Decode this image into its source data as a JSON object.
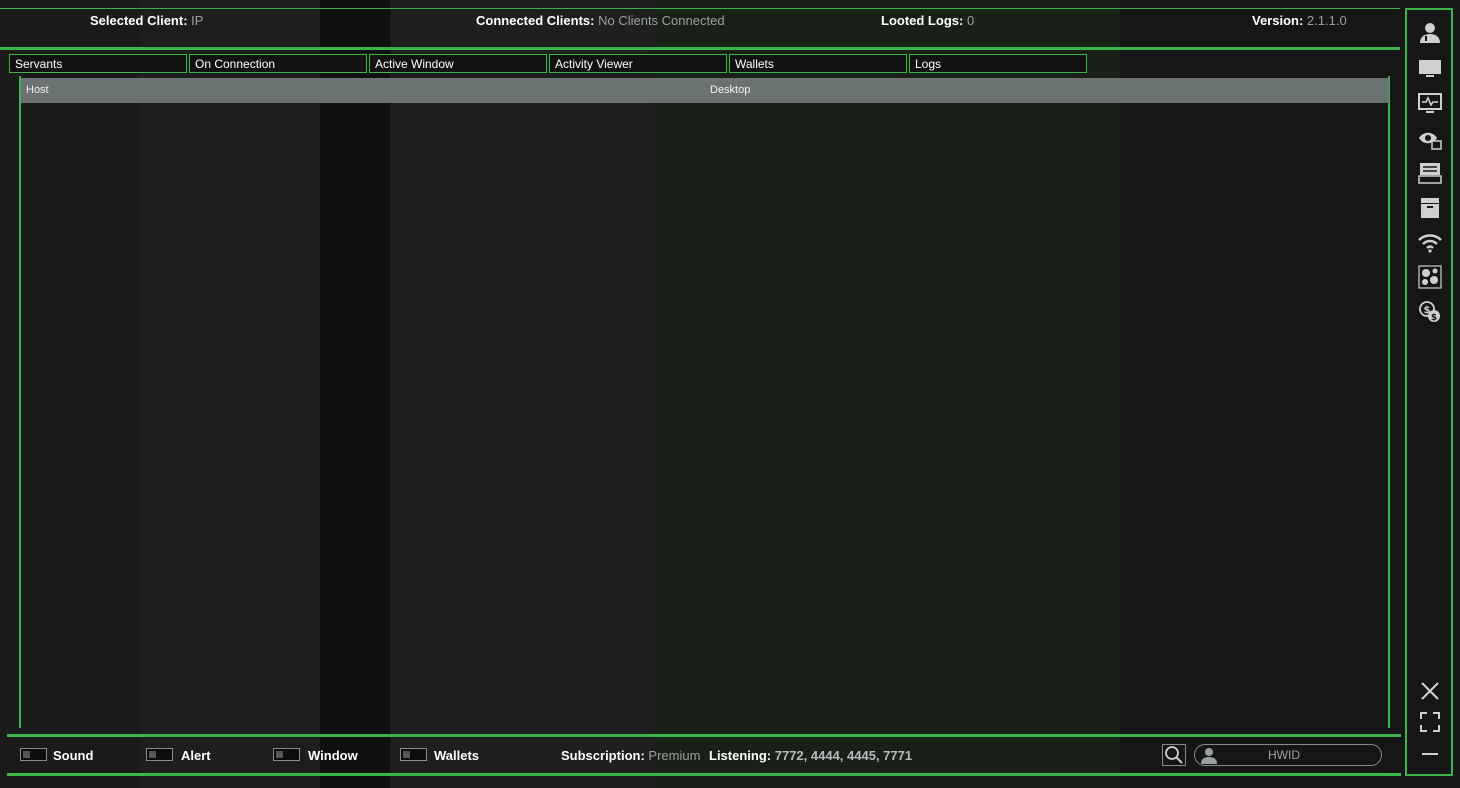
{
  "header": {
    "selected_client_label": "Selected Client:",
    "selected_client_value": "IP",
    "connected_clients_label": "Connected Clients:",
    "connected_clients_value": "No Clients Connected",
    "looted_logs_label": "Looted Logs:",
    "looted_logs_value": "0",
    "version_label": "Version:",
    "version_value": "2.1.1.0"
  },
  "tabs": [
    "Servants",
    "On Connection",
    "Active Window",
    "Activity Viewer",
    "Wallets",
    "Logs"
  ],
  "table": {
    "columns": [
      "Host",
      "Desktop"
    ]
  },
  "footer": {
    "toggles": [
      "Sound",
      "Alert",
      "Window",
      "Wallets"
    ],
    "subscription_label": "Subscription:",
    "subscription_value": "Premium",
    "listening_label": "Listening:",
    "listening_value": "7772, 4444, 4445, 7771",
    "hwid_placeholder": "HWID"
  },
  "sidebar_icons": [
    "user-icon",
    "monitor-icon",
    "activity-monitor-icon",
    "watch-eye-icon",
    "log-keyboard-icon",
    "archive-box-icon",
    "wifi-icon",
    "modules-icon",
    "currency-exchange-icon"
  ],
  "window_controls": [
    "close-icon",
    "maximize-icon",
    "minimize-icon"
  ],
  "colors": {
    "accent": "#39b54a",
    "header_row": "#6a7272",
    "background": "#161616",
    "muted_text": "#9aa0a0"
  }
}
